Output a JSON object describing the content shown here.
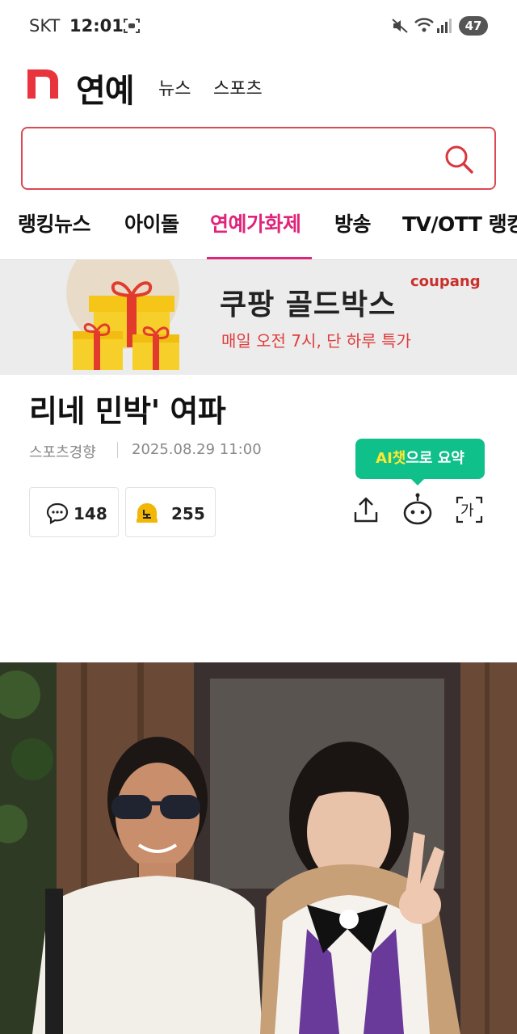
{
  "status_bar": {
    "carrier": "SKT",
    "time": "12:01",
    "battery": "47"
  },
  "header": {
    "section_title": "연예",
    "nav_links": [
      "뉴스",
      "스포츠"
    ]
  },
  "search": {
    "placeholder": "",
    "value": ""
  },
  "tabs": {
    "items": [
      "랭킹뉴스",
      "아이돌",
      "연예가화제",
      "방송",
      "TV/OTT 랭킹"
    ],
    "active": "연예가화제"
  },
  "ad": {
    "title": "쿠팡 골드박스",
    "subtitle": "매일 오전 7시, 단 하루 특가",
    "brand": "coupang"
  },
  "article": {
    "title": "리네 민박' 여파",
    "source": "스포츠경향",
    "date": "2025.08.29 11:00",
    "comment_count": "148",
    "reaction_count": "255",
    "ai_summary_highlight": "AI챗",
    "ai_summary_rest": "으로 요약",
    "font_size_label": "가"
  },
  "colors": {
    "brand_red": "#e8343c",
    "active_tab": "#e0247a",
    "search_border": "#d94a52",
    "ai_green": "#10c08a"
  }
}
